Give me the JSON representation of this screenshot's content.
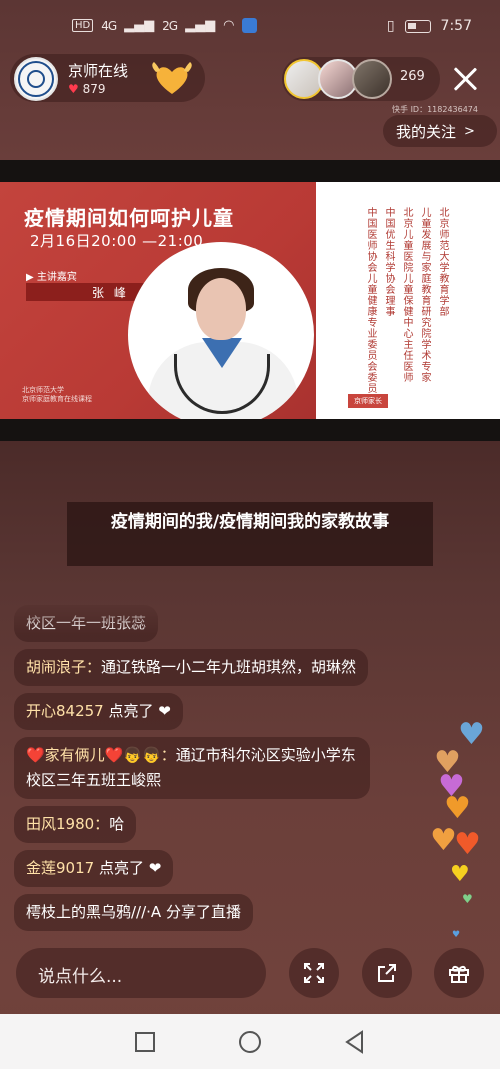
{
  "status_bar": {
    "hd1": "HD",
    "sig1": "4G",
    "sig2": "2G",
    "time": "7:57"
  },
  "host": {
    "name": "京师在线",
    "likes": "879"
  },
  "viewers": {
    "count": "269"
  },
  "ks_id": "快手 ID：1182436474",
  "my_follow": "我的关注",
  "slide": {
    "title": "疫情期间如何呵护儿童",
    "date": "2月16日20:00 —21:00",
    "guest_label": "▶ 主讲嘉宾",
    "guest_name": "张 峰",
    "logo_line1": "北京师范大学",
    "logo_line2": "京师家庭教育在线课程",
    "right_col1": "北京师范大学教育学部",
    "right_col2": "儿童发展与家庭教育研究院学术专家",
    "right_col3": "北京儿童医院儿童保健中心主任医师",
    "right_col4": "中国优生科学协会理事",
    "right_col5": "中国医师协会儿童健康专业委员会委员",
    "footer_badge": "京师家长"
  },
  "caption": "疫情期间的我/疫情期间我的家教故事",
  "comments": [
    {
      "user": "",
      "text": "校区一年一班张蕊"
    },
    {
      "user": "胡闹浪子：",
      "text": "通辽铁路一小二年九班胡琪然，胡琳然"
    },
    {
      "user": "开心84257",
      "text": " 点亮了 ❤"
    },
    {
      "user": "❤️家有俩儿❤️👦👦：",
      "text": "通辽市科尔沁区实验小学东校区三年五班王峻熙"
    },
    {
      "user": "田风1980：",
      "text": "哈"
    },
    {
      "user": "金莲9017",
      "text": " 点亮了 ❤"
    },
    {
      "user": "",
      "text": "樗枝上的黑乌鸦///·A 分享了直播"
    }
  ],
  "input": {
    "placeholder": "说点什么..."
  },
  "colors": {
    "accent_red": "#c3443d",
    "heart": "#ff3b4e",
    "username": "#ffe1a8"
  },
  "icons": [
    "expand-icon",
    "share-icon",
    "gift-icon",
    "close-icon"
  ]
}
